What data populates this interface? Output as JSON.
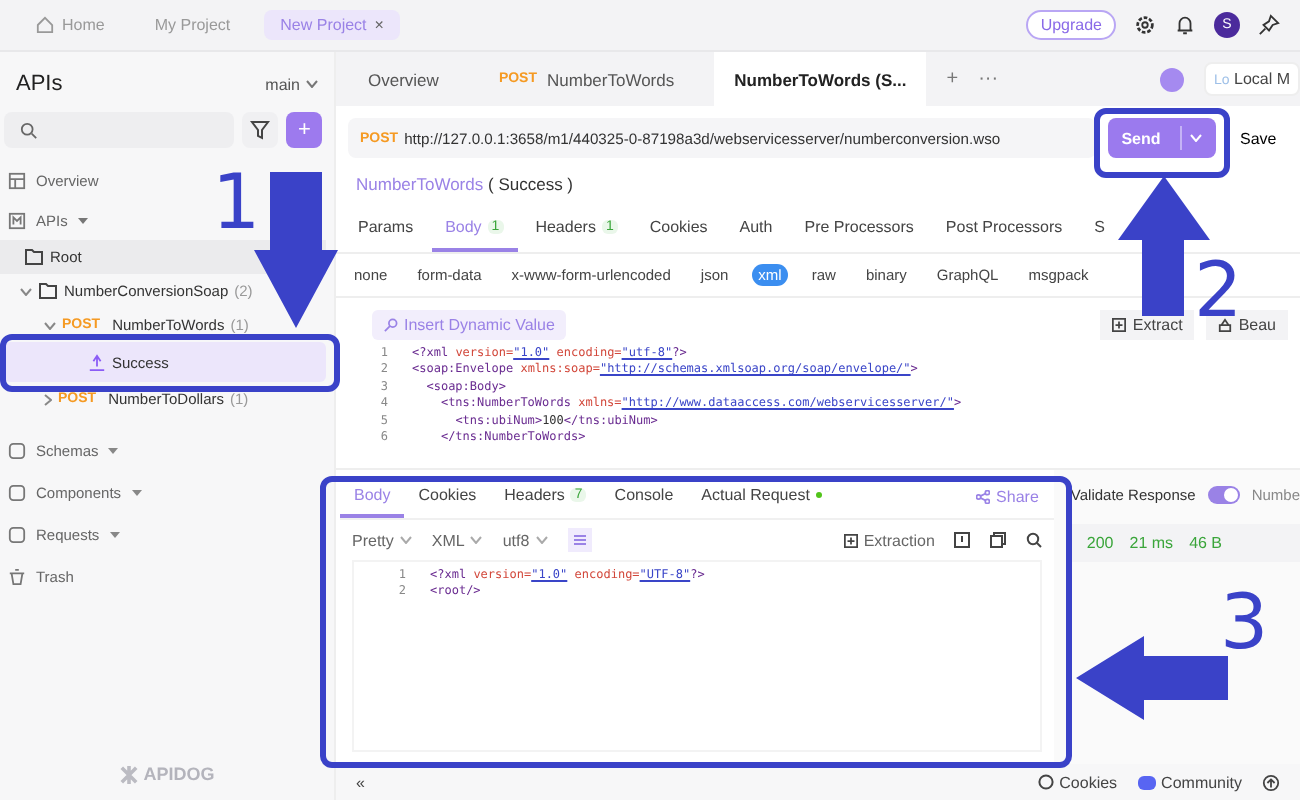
{
  "top_tabs": [
    {
      "label": "Home",
      "selected": false
    },
    {
      "label": "My Project",
      "selected": false
    },
    {
      "label": "New Project",
      "selected": true,
      "close": "×"
    }
  ],
  "upgrade": "Upgrade",
  "avatar": "S",
  "sidebar": {
    "title": "APIs",
    "branch": "main",
    "add": "+",
    "overview": "Overview",
    "apis": "APIs",
    "tree": [
      {
        "label": "Root",
        "kind": "folder",
        "selected": false,
        "children": [
          {
            "label": "NumberConversionSoap",
            "count": "(2)",
            "kind": "folder",
            "expanded": true,
            "selected": false,
            "children": [
              {
                "method": "POST",
                "label": "NumberToWords",
                "count": "(1)",
                "kind": "endpoint",
                "expanded": true,
                "selected": false,
                "children": [
                  {
                    "label": "Success",
                    "kind": "case",
                    "selected": true
                  }
                ]
              },
              {
                "method": "POST",
                "label": "NumberToDollars",
                "count": "(1)",
                "kind": "endpoint",
                "expanded": false,
                "selected": false
              }
            ]
          }
        ]
      }
    ],
    "bottom_nav": [
      "Schemas",
      "Components",
      "Requests",
      "Trash"
    ],
    "logo": "APIDOG"
  },
  "main_tabs": [
    {
      "label": "Overview",
      "selected": false
    },
    {
      "method": "POST",
      "label": "NumberToWords",
      "selected": false
    },
    {
      "label": "NumberToWords (S...",
      "selected": true
    }
  ],
  "tab_add": "+",
  "tab_more": "···",
  "env": {
    "badge": "Lo",
    "label": "Local M"
  },
  "request": {
    "method": "POST",
    "url": "http://127.0.0.1:3658/m1/440325-0-87198a3d/webservicesserver/numberconversion.wso",
    "send": "Send",
    "save": "Save",
    "name": "NumberToWords",
    "case": "( Success )",
    "tabs": [
      {
        "label": "Params",
        "selected": false
      },
      {
        "label": "Body",
        "count": "1",
        "selected": true
      },
      {
        "label": "Headers",
        "count": "1",
        "selected": false
      },
      {
        "label": "Cookies",
        "selected": false
      },
      {
        "label": "Auth",
        "selected": false
      },
      {
        "label": "Pre Processors",
        "selected": false
      },
      {
        "label": "Post Processors",
        "selected": false
      },
      {
        "label": "S",
        "selected": false
      }
    ],
    "body_types": [
      {
        "label": "none",
        "selected": false
      },
      {
        "label": "form-data",
        "selected": false
      },
      {
        "label": "x-www-form-urlencoded",
        "selected": false
      },
      {
        "label": "json",
        "selected": false
      },
      {
        "label": "xml",
        "selected": true
      },
      {
        "label": "raw",
        "selected": false
      },
      {
        "label": "binary",
        "selected": false
      },
      {
        "label": "GraphQL",
        "selected": false
      },
      {
        "label": "msgpack",
        "selected": false
      }
    ],
    "insert": "Insert Dynamic Value",
    "extract": "Extract",
    "beautify": "Beau",
    "code": [
      {
        "n": "1",
        "text": "<?xml version=\"1.0\" encoding=\"utf-8\"?>"
      },
      {
        "n": "2",
        "text": "<soap:Envelope xmlns:soap=\"http://schemas.xmlsoap.org/soap/envelope/\">"
      },
      {
        "n": "3",
        "text": "  <soap:Body>"
      },
      {
        "n": "4",
        "text": "    <tns:NumberToWords xmlns=\"http://www.dataaccess.com/webservicesserver/\">"
      },
      {
        "n": "5",
        "text": "      <tns:ubiNum>100</tns:ubiNum>"
      },
      {
        "n": "6",
        "text": "    </tns:NumberToWords>"
      }
    ]
  },
  "response": {
    "tabs": [
      {
        "label": "Body",
        "selected": true
      },
      {
        "label": "Cookies",
        "selected": false
      },
      {
        "label": "Headers",
        "count": "7",
        "selected": false
      },
      {
        "label": "Console",
        "selected": false
      },
      {
        "label": "Actual Request",
        "selected": false,
        "color": "#52c41a"
      }
    ],
    "share": "Share",
    "format": [
      "Pretty",
      "XML",
      "utf8"
    ],
    "extraction": "Extraction",
    "code": [
      {
        "n": "1",
        "text": "<?xml version=\"1.0\" encoding=\"UTF-8\"?>"
      },
      {
        "n": "2",
        "text": "<root/>"
      }
    ],
    "validate": "Validate Response",
    "validate_on": true,
    "number": "Numbe",
    "status": "200",
    "time": "21 ms",
    "size": "46 B"
  },
  "footer": {
    "collapse": "«",
    "cookies": "Cookies",
    "community": "Community"
  },
  "annotations": [
    {
      "label": "1",
      "kind": "down"
    },
    {
      "label": "2",
      "kind": "up"
    },
    {
      "label": "3",
      "kind": "left"
    }
  ]
}
